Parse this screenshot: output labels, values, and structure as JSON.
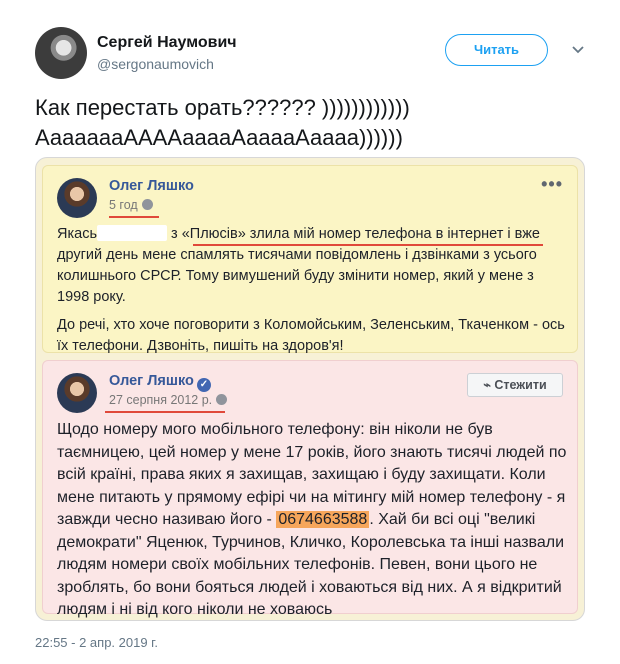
{
  "tweet": {
    "author_name": "Сергей Наумович",
    "author_handle": "@sergonaumovich",
    "follow_label": "Читать",
    "line1": "Как перестать орать?????? ))))))))))))",
    "line2": "АааааааААААааааАааааАаааа))))))",
    "timestamp": "22:55 - 2 апр. 2019 г."
  },
  "post1": {
    "author": "Олег Ляшко",
    "time": "5 год",
    "p1_a": "Якась",
    "p1_b": " з «Плюсів» злила мій номер телефона в інтернет і вже другий день мене спамлять тисячами повідомлень і дзвінками з усього колишнього СРСР. Тому вимушений буду змінити номер, який у мене з 1998 року.",
    "p2": "До речі, хто хоче поговорити з Коломойським, Зеленським, Ткаченком - ось їх телефони. Дзвоніть, пишіть на здоров'я!"
  },
  "post2": {
    "author": "Олег Ляшко",
    "time": "27 серпня 2012 р.",
    "follow_label": "Стежити",
    "text_a": "Щодо номеру мого мобільного телефону: він ніколи не був таємницею, цей номер у мене 17 років, його знають тисячі людей по всій країні, права яких я захищав, захищаю і буду захищати. Коли мене питають у прямому ефірі чи на мітингу мій номер телефону - я завжди чесно називаю його - ",
    "phone": "0674663588",
    "text_b": ". Хай би всі оці \"великі демократи\" Яценюк, Турчинов, Кличко, Королевська та інші назвали людям номери своїх мобільних телефонів. Певен, вони цього не зроблять, бо вони бояться людей і ховаються від них. А я відкритий людям і ні від кого ніколи не ховаюсь"
  },
  "icons": {
    "more": "•••",
    "caret": "chevron-down-icon",
    "verified": "✓",
    "rss": "rss-icon"
  },
  "colors": {
    "accent": "#1da1f2",
    "fb_link": "#365899",
    "phone_highlight": "#f6a65b",
    "post1_bg": "#fbf5c5",
    "post2_bg": "#fbe6e6"
  }
}
